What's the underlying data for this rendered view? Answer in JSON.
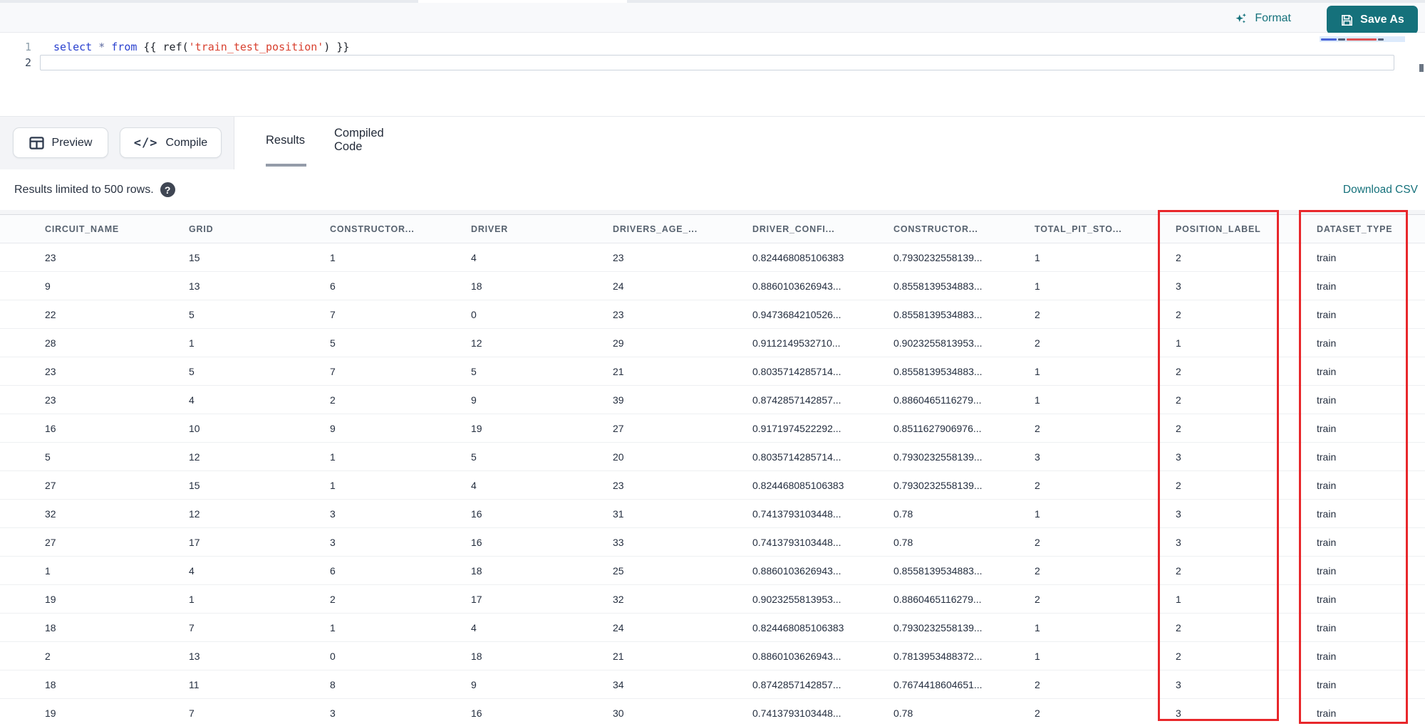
{
  "toolbar": {
    "format_label": "Format",
    "save_as_label": "Save As"
  },
  "editor": {
    "lines": [
      {
        "number": "1",
        "tokens": [
          {
            "text": "select",
            "type": "keyword"
          },
          {
            "text": " ",
            "type": "plain"
          },
          {
            "text": "*",
            "type": "operator"
          },
          {
            "text": " ",
            "type": "plain"
          },
          {
            "text": "from",
            "type": "keyword"
          },
          {
            "text": " {{ ",
            "type": "plain"
          },
          {
            "text": "ref(",
            "type": "plain"
          },
          {
            "text": "'train_test_position'",
            "type": "string"
          },
          {
            "text": ") }}",
            "type": "plain"
          }
        ]
      },
      {
        "number": "2",
        "tokens": []
      }
    ]
  },
  "actions": {
    "preview_label": "Preview",
    "compile_label": "Compile",
    "compile_glyph": "</>"
  },
  "tabs": [
    {
      "label": "Results",
      "active": true
    },
    {
      "label": "Compiled Code",
      "active": false
    }
  ],
  "results": {
    "limit_note": "Results limited to 500 rows.",
    "help_glyph": "?",
    "download_label": "Download CSV"
  },
  "table": {
    "columns": [
      "CIRCUIT_NAME",
      "GRID",
      "CONSTRUCTOR...",
      "DRIVER",
      "DRIVERS_AGE_...",
      "DRIVER_CONFI...",
      "CONSTRUCTOR...",
      "TOTAL_PIT_STO...",
      "POSITION_LABEL",
      "DATASET_TYPE"
    ],
    "highlighted_columns": [
      "POSITION_LABEL",
      "DATASET_TYPE"
    ],
    "rows": [
      [
        "23",
        "15",
        "1",
        "4",
        "23",
        "0.824468085106383",
        "0.7930232558139...",
        "1",
        "2",
        "train"
      ],
      [
        "9",
        "13",
        "6",
        "18",
        "24",
        "0.8860103626943...",
        "0.8558139534883...",
        "1",
        "3",
        "train"
      ],
      [
        "22",
        "5",
        "7",
        "0",
        "23",
        "0.9473684210526...",
        "0.8558139534883...",
        "2",
        "2",
        "train"
      ],
      [
        "28",
        "1",
        "5",
        "12",
        "29",
        "0.9112149532710...",
        "0.9023255813953...",
        "2",
        "1",
        "train"
      ],
      [
        "23",
        "5",
        "7",
        "5",
        "21",
        "0.8035714285714...",
        "0.8558139534883...",
        "1",
        "2",
        "train"
      ],
      [
        "23",
        "4",
        "2",
        "9",
        "39",
        "0.8742857142857...",
        "0.8860465116279...",
        "1",
        "2",
        "train"
      ],
      [
        "16",
        "10",
        "9",
        "19",
        "27",
        "0.9171974522292...",
        "0.8511627906976...",
        "2",
        "2",
        "train"
      ],
      [
        "5",
        "12",
        "1",
        "5",
        "20",
        "0.8035714285714...",
        "0.7930232558139...",
        "3",
        "3",
        "train"
      ],
      [
        "27",
        "15",
        "1",
        "4",
        "23",
        "0.824468085106383",
        "0.7930232558139...",
        "2",
        "2",
        "train"
      ],
      [
        "32",
        "12",
        "3",
        "16",
        "31",
        "0.7413793103448...",
        "0.78",
        "1",
        "3",
        "train"
      ],
      [
        "27",
        "17",
        "3",
        "16",
        "33",
        "0.7413793103448...",
        "0.78",
        "2",
        "3",
        "train"
      ],
      [
        "1",
        "4",
        "6",
        "18",
        "25",
        "0.8860103626943...",
        "0.8558139534883...",
        "2",
        "2",
        "train"
      ],
      [
        "19",
        "1",
        "2",
        "17",
        "32",
        "0.9023255813953...",
        "0.8860465116279...",
        "2",
        "1",
        "train"
      ],
      [
        "18",
        "7",
        "1",
        "4",
        "24",
        "0.824468085106383",
        "0.7930232558139...",
        "1",
        "2",
        "train"
      ],
      [
        "2",
        "13",
        "0",
        "18",
        "21",
        "0.8860103626943...",
        "0.7813953488372...",
        "1",
        "2",
        "train"
      ],
      [
        "18",
        "11",
        "8",
        "9",
        "34",
        "0.8742857142857...",
        "0.7674418604651...",
        "2",
        "3",
        "train"
      ],
      [
        "19",
        "7",
        "3",
        "16",
        "30",
        "0.7413793103448...",
        "0.78",
        "2",
        "3",
        "train"
      ]
    ]
  },
  "colors": {
    "accent_teal": "#15717b",
    "highlight_red": "#e8272b",
    "keyword_blue": "#2a41cf",
    "string_red": "#d8402f"
  }
}
